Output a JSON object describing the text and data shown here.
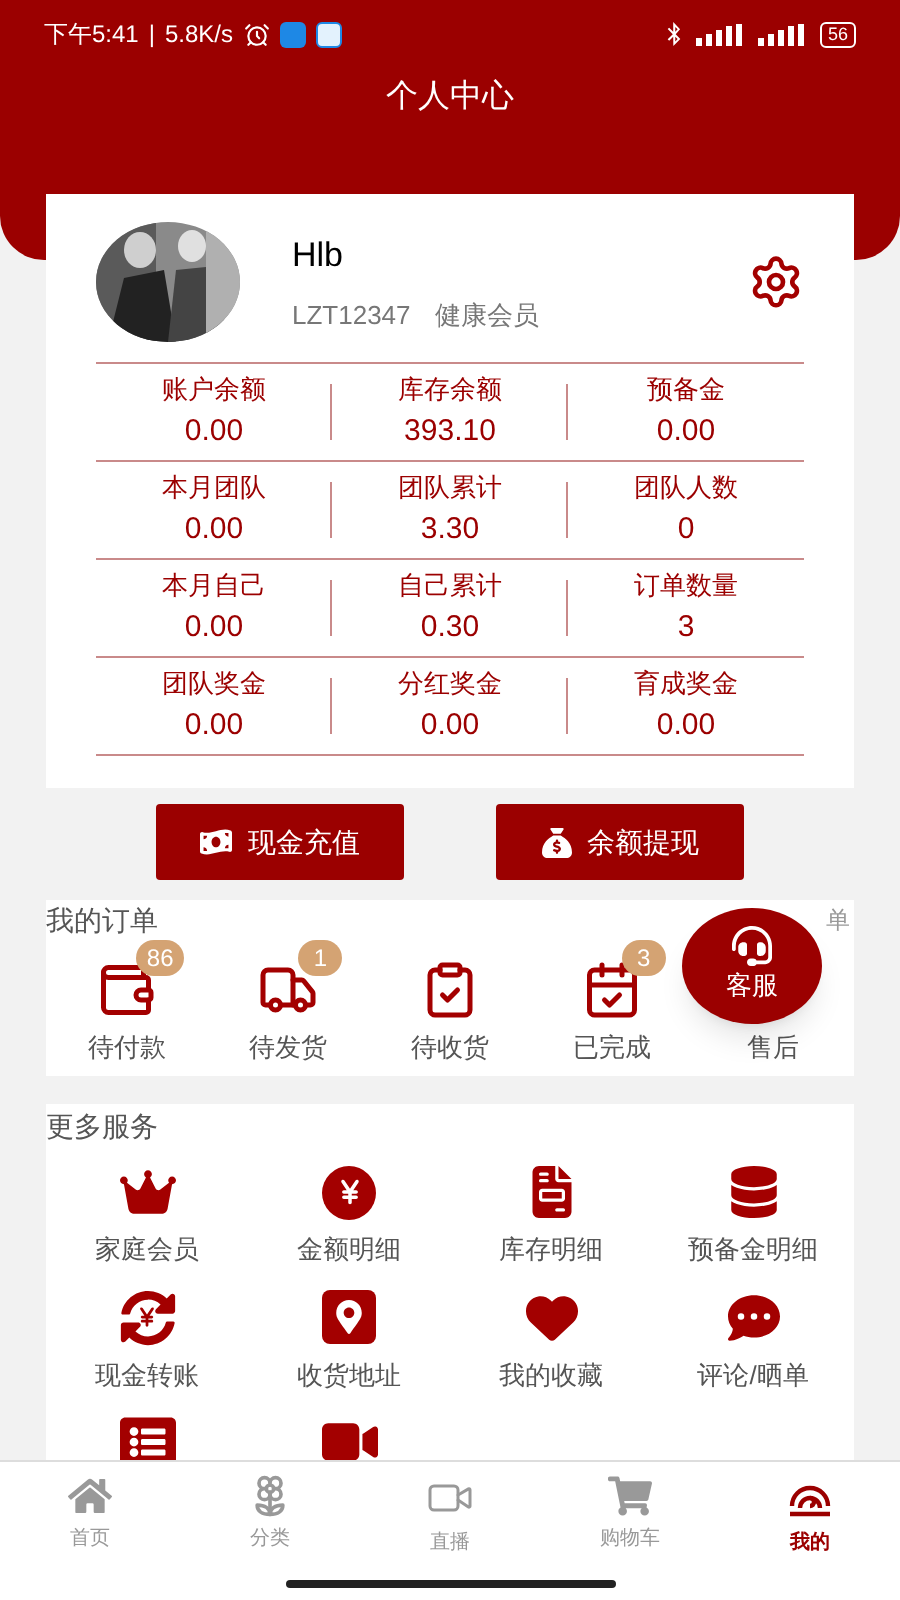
{
  "status_bar": {
    "time": "下午5:41",
    "separator": "|",
    "speed": "5.8K/s",
    "battery": "56"
  },
  "header": {
    "title": "个人中心"
  },
  "profile": {
    "name": "Hlb",
    "member_id": "LZT12347",
    "member_level": "健康会员"
  },
  "stats": [
    {
      "label": "账户余额",
      "value": "0.00"
    },
    {
      "label": "库存余额",
      "value": "393.10"
    },
    {
      "label": "预备金",
      "value": "0.00"
    },
    {
      "label": "本月团队",
      "value": "0.00"
    },
    {
      "label": "团队累计",
      "value": "3.30"
    },
    {
      "label": "团队人数",
      "value": "0"
    },
    {
      "label": "本月自己",
      "value": "0.00"
    },
    {
      "label": "自己累计",
      "value": "0.30"
    },
    {
      "label": "订单数量",
      "value": "3"
    },
    {
      "label": "团队奖金",
      "value": "0.00"
    },
    {
      "label": "分红奖金",
      "value": "0.00"
    },
    {
      "label": "育成奖金",
      "value": "0.00"
    }
  ],
  "actions": [
    {
      "kind": "recharge",
      "label": "现金充值"
    },
    {
      "kind": "withdraw",
      "label": "余额提现"
    }
  ],
  "orders": {
    "title": "我的订单",
    "link": "单",
    "items": [
      {
        "kind": "wallet",
        "label": "待付款",
        "badge": "86"
      },
      {
        "kind": "truck",
        "label": "待发货",
        "badge": "1"
      },
      {
        "kind": "clipboard",
        "label": "待收货"
      },
      {
        "kind": "calendar",
        "label": "已完成",
        "badge": "3"
      },
      {
        "kind": "covered",
        "label": "售后"
      }
    ]
  },
  "service_fab": {
    "label": "客服"
  },
  "services": {
    "title": "更多服务",
    "items": [
      {
        "kind": "crown",
        "label": "家庭会员"
      },
      {
        "kind": "yen",
        "label": "金额明细"
      },
      {
        "kind": "stock",
        "label": "库存明细"
      },
      {
        "kind": "coins",
        "label": "预备金明细"
      },
      {
        "kind": "exchange",
        "label": "现金转账"
      },
      {
        "kind": "location",
        "label": "收货地址"
      },
      {
        "kind": "heart",
        "label": "我的收藏"
      },
      {
        "kind": "comment",
        "label": "评论/晒单"
      },
      {
        "kind": "form"
      },
      {
        "kind": "camera"
      }
    ]
  },
  "tab_bar": [
    {
      "kind": "home",
      "label": "首页",
      "selected": false
    },
    {
      "kind": "lotus",
      "label": "分类",
      "selected": false
    },
    {
      "kind": "video",
      "label": "直播",
      "selected": false
    },
    {
      "kind": "cart",
      "label": "购物车",
      "selected": false
    },
    {
      "kind": "mine",
      "label": "我的",
      "selected": true
    }
  ]
}
